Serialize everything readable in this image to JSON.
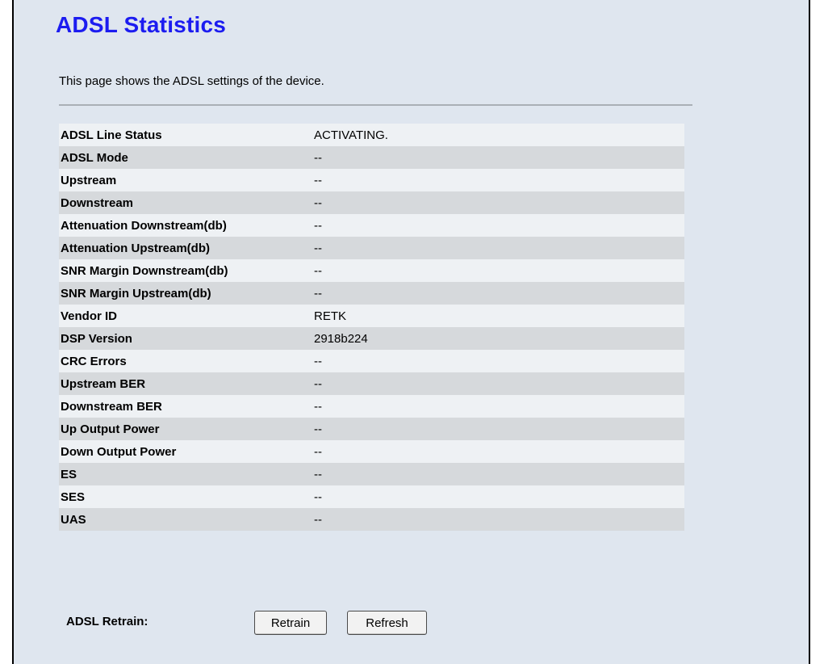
{
  "page": {
    "title": "ADSL Statistics",
    "description": "This page shows the ADSL settings of the device."
  },
  "stats": [
    {
      "label": "ADSL Line Status",
      "value": "ACTIVATING."
    },
    {
      "label": "ADSL Mode",
      "value": "--"
    },
    {
      "label": "Upstream",
      "value": "--"
    },
    {
      "label": "Downstream",
      "value": "--"
    },
    {
      "label": "Attenuation Downstream(db)",
      "value": "--"
    },
    {
      "label": "Attenuation Upstream(db)",
      "value": "--"
    },
    {
      "label": "SNR Margin Downstream(db)",
      "value": "--"
    },
    {
      "label": "SNR Margin Upstream(db)",
      "value": "--"
    },
    {
      "label": "Vendor ID",
      "value": "RETK"
    },
    {
      "label": "DSP Version",
      "value": "2918b224"
    },
    {
      "label": "CRC Errors",
      "value": "--"
    },
    {
      "label": "Upstream BER",
      "value": "--"
    },
    {
      "label": "Downstream BER",
      "value": "--"
    },
    {
      "label": "Up Output Power",
      "value": "--"
    },
    {
      "label": "Down Output Power",
      "value": "--"
    },
    {
      "label": "ES",
      "value": "--"
    },
    {
      "label": "SES",
      "value": "--"
    },
    {
      "label": "UAS",
      "value": "--"
    }
  ],
  "retrain": {
    "label": "ADSL Retrain:",
    "retrain_button": "Retrain",
    "refresh_button": "Refresh"
  },
  "colors": {
    "title": "#1c1cf0",
    "panel_background": "#dfe6ef",
    "row_light": "#eef1f4",
    "row_dark": "#d6d9dc"
  }
}
